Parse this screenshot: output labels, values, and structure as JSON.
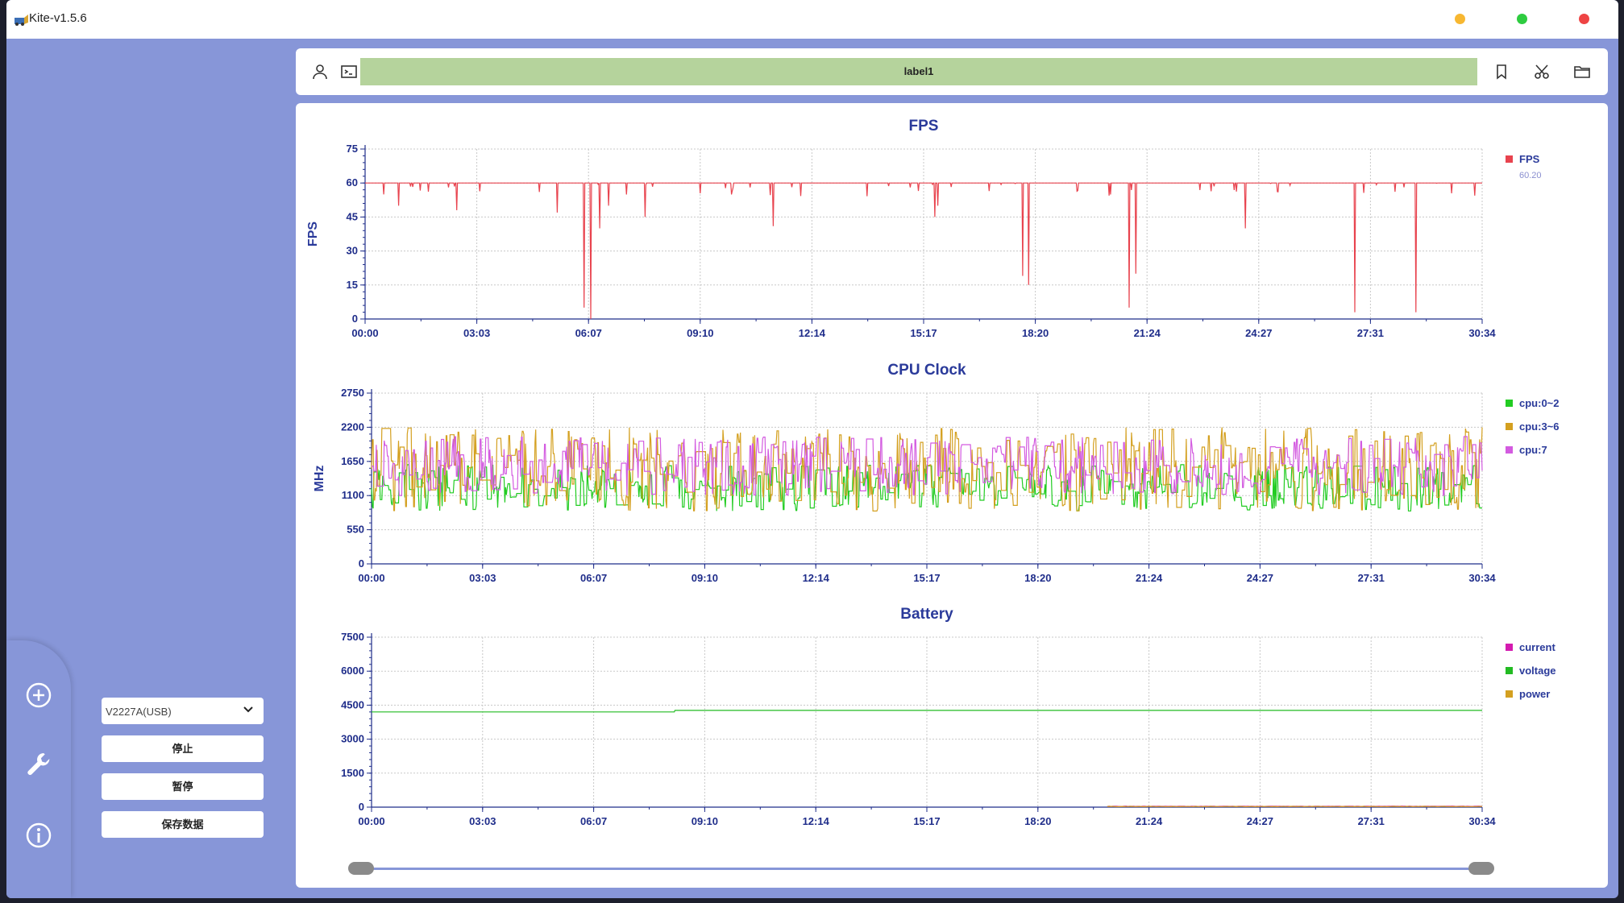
{
  "window": {
    "title": "Kite-v1.5.6",
    "dot_colors": [
      "#f7b731",
      "#2ecc40",
      "#ee4444"
    ]
  },
  "sidebar": {
    "icons": [
      "add-circle-icon",
      "wrench-icon",
      "info-icon"
    ],
    "device_select": "V2227A(USB)",
    "buttons": {
      "stop": "停止",
      "pause": "暂停",
      "save": "保存数据"
    }
  },
  "topbar": {
    "label": "label1",
    "left_icons": [
      "user-icon",
      "terminal-icon"
    ],
    "right_icons": [
      "bookmark-icon",
      "scissors-icon",
      "folder-icon"
    ],
    "label_color": "#b5d39c"
  },
  "chart_data": [
    {
      "type": "line",
      "title": "FPS",
      "ylabel": "FPS",
      "ylim": [
        0,
        75
      ],
      "yticks": [
        "0",
        "15",
        "30",
        "45",
        "60",
        "75"
      ],
      "xticks": [
        "00:00",
        "03:03",
        "06:07",
        "09:10",
        "12:14",
        "15:17",
        "18:20",
        "21:24",
        "24:27",
        "27:31",
        "30:34"
      ],
      "xlim_seconds": [
        0,
        1834
      ],
      "series": [
        {
          "name": "FPS",
          "color": "#e8434e",
          "baseline": 60,
          "dips": [
            [
              30,
              55
            ],
            [
              55,
              50
            ],
            [
              150,
              48
            ],
            [
              315,
              47
            ],
            [
              360,
              5
            ],
            [
              370,
              0
            ],
            [
              385,
              40
            ],
            [
              400,
              50
            ],
            [
              460,
              45
            ],
            [
              670,
              41
            ],
            [
              935,
              45
            ],
            [
              940,
              50
            ],
            [
              1080,
              19
            ],
            [
              1090,
              15
            ],
            [
              1255,
              5
            ],
            [
              1265,
              20
            ],
            [
              1445,
              40
            ],
            [
              1625,
              3
            ],
            [
              1725,
              3
            ]
          ]
        }
      ],
      "legend": [
        {
          "name": "FPS",
          "value": "60.20",
          "color": "#e8434e"
        }
      ],
      "grid": true,
      "legend_position": "right"
    },
    {
      "type": "line",
      "title": "CPU Clock",
      "ylabel": "MHz",
      "ylim": [
        0,
        2750
      ],
      "yticks": [
        "0",
        "550",
        "1100",
        "1650",
        "2200",
        "2750"
      ],
      "xticks": [
        "00:00",
        "03:03",
        "06:07",
        "09:10",
        "12:14",
        "15:17",
        "18:20",
        "21:24",
        "24:27",
        "27:31",
        "30:34"
      ],
      "xlim_seconds": [
        0,
        1834
      ],
      "series": [
        {
          "name": "cpu:0~2",
          "color": "#22cc22",
          "range": [
            850,
            1600
          ]
        },
        {
          "name": "cpu:3~6",
          "color": "#d4a020",
          "range": [
            850,
            2200
          ]
        },
        {
          "name": "cpu:7",
          "color": "#d35be0",
          "range": [
            1100,
            2050
          ]
        }
      ],
      "legend": [
        {
          "name": "cpu:0~2",
          "color": "#22cc22"
        },
        {
          "name": "cpu:3~6",
          "color": "#d4a020"
        },
        {
          "name": "cpu:7",
          "color": "#d35be0"
        }
      ],
      "grid": true,
      "legend_position": "right"
    },
    {
      "type": "line",
      "title": "Battery",
      "ylim": [
        0,
        7500
      ],
      "yticks": [
        "0",
        "1500",
        "3000",
        "4500",
        "6000",
        "7500"
      ],
      "xticks": [
        "00:00",
        "03:03",
        "06:07",
        "09:10",
        "12:14",
        "15:17",
        "18:20",
        "21:24",
        "24:27",
        "27:31",
        "30:34"
      ],
      "xlim_seconds": [
        0,
        1834
      ],
      "series": [
        {
          "name": "current",
          "color": "#d41bb0",
          "start_s": 1215,
          "value": 30
        },
        {
          "name": "voltage",
          "color": "#22bb22",
          "points": [
            [
              0,
              4200
            ],
            [
              500,
              4200
            ],
            [
              501,
              4270
            ],
            [
              1834,
              4270
            ]
          ]
        },
        {
          "name": "power",
          "color": "#d4a020",
          "start_s": 1215,
          "value": 20
        }
      ],
      "legend": [
        {
          "name": "current",
          "color": "#d41bb0"
        },
        {
          "name": "voltage",
          "color": "#22bb22"
        },
        {
          "name": "power",
          "color": "#d4a020"
        }
      ],
      "grid": true,
      "legend_position": "right"
    }
  ],
  "range_slider": {
    "start": 0,
    "end": 1
  }
}
